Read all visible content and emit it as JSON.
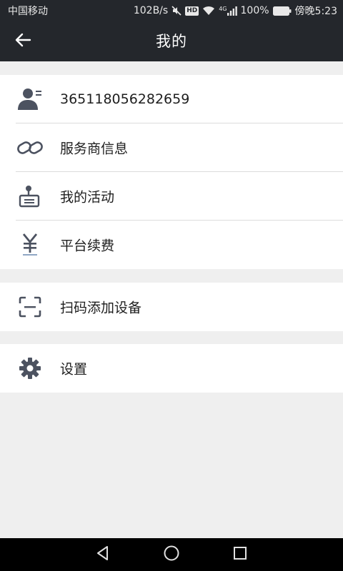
{
  "status_bar": {
    "carrier": "中国移动",
    "speed": "102B/s",
    "hd_badge": "HD",
    "network": "4G",
    "battery": "100%",
    "time": "傍晚5:23"
  },
  "header": {
    "title": "我的",
    "back_icon": "arrow-left-icon"
  },
  "menu": {
    "group1": [
      {
        "label": "365118056282659",
        "icon": "user-card-icon"
      },
      {
        "label": "服务商信息",
        "icon": "link-icon"
      },
      {
        "label": "我的活动",
        "icon": "activity-icon"
      },
      {
        "label": "平台续费",
        "icon": "yuan-icon"
      }
    ],
    "group2": [
      {
        "label": "扫码添加设备",
        "icon": "scan-icon"
      }
    ],
    "group3": [
      {
        "label": "设置",
        "icon": "gear-icon"
      }
    ]
  },
  "nav_bar": {
    "back": "triangle-back-icon",
    "home": "circle-home-icon",
    "recents": "square-recents-icon"
  },
  "colors": {
    "header_bg": "#24272c",
    "page_bg": "#efefef",
    "icon": "#4c5260",
    "text": "#1e1e1e"
  }
}
